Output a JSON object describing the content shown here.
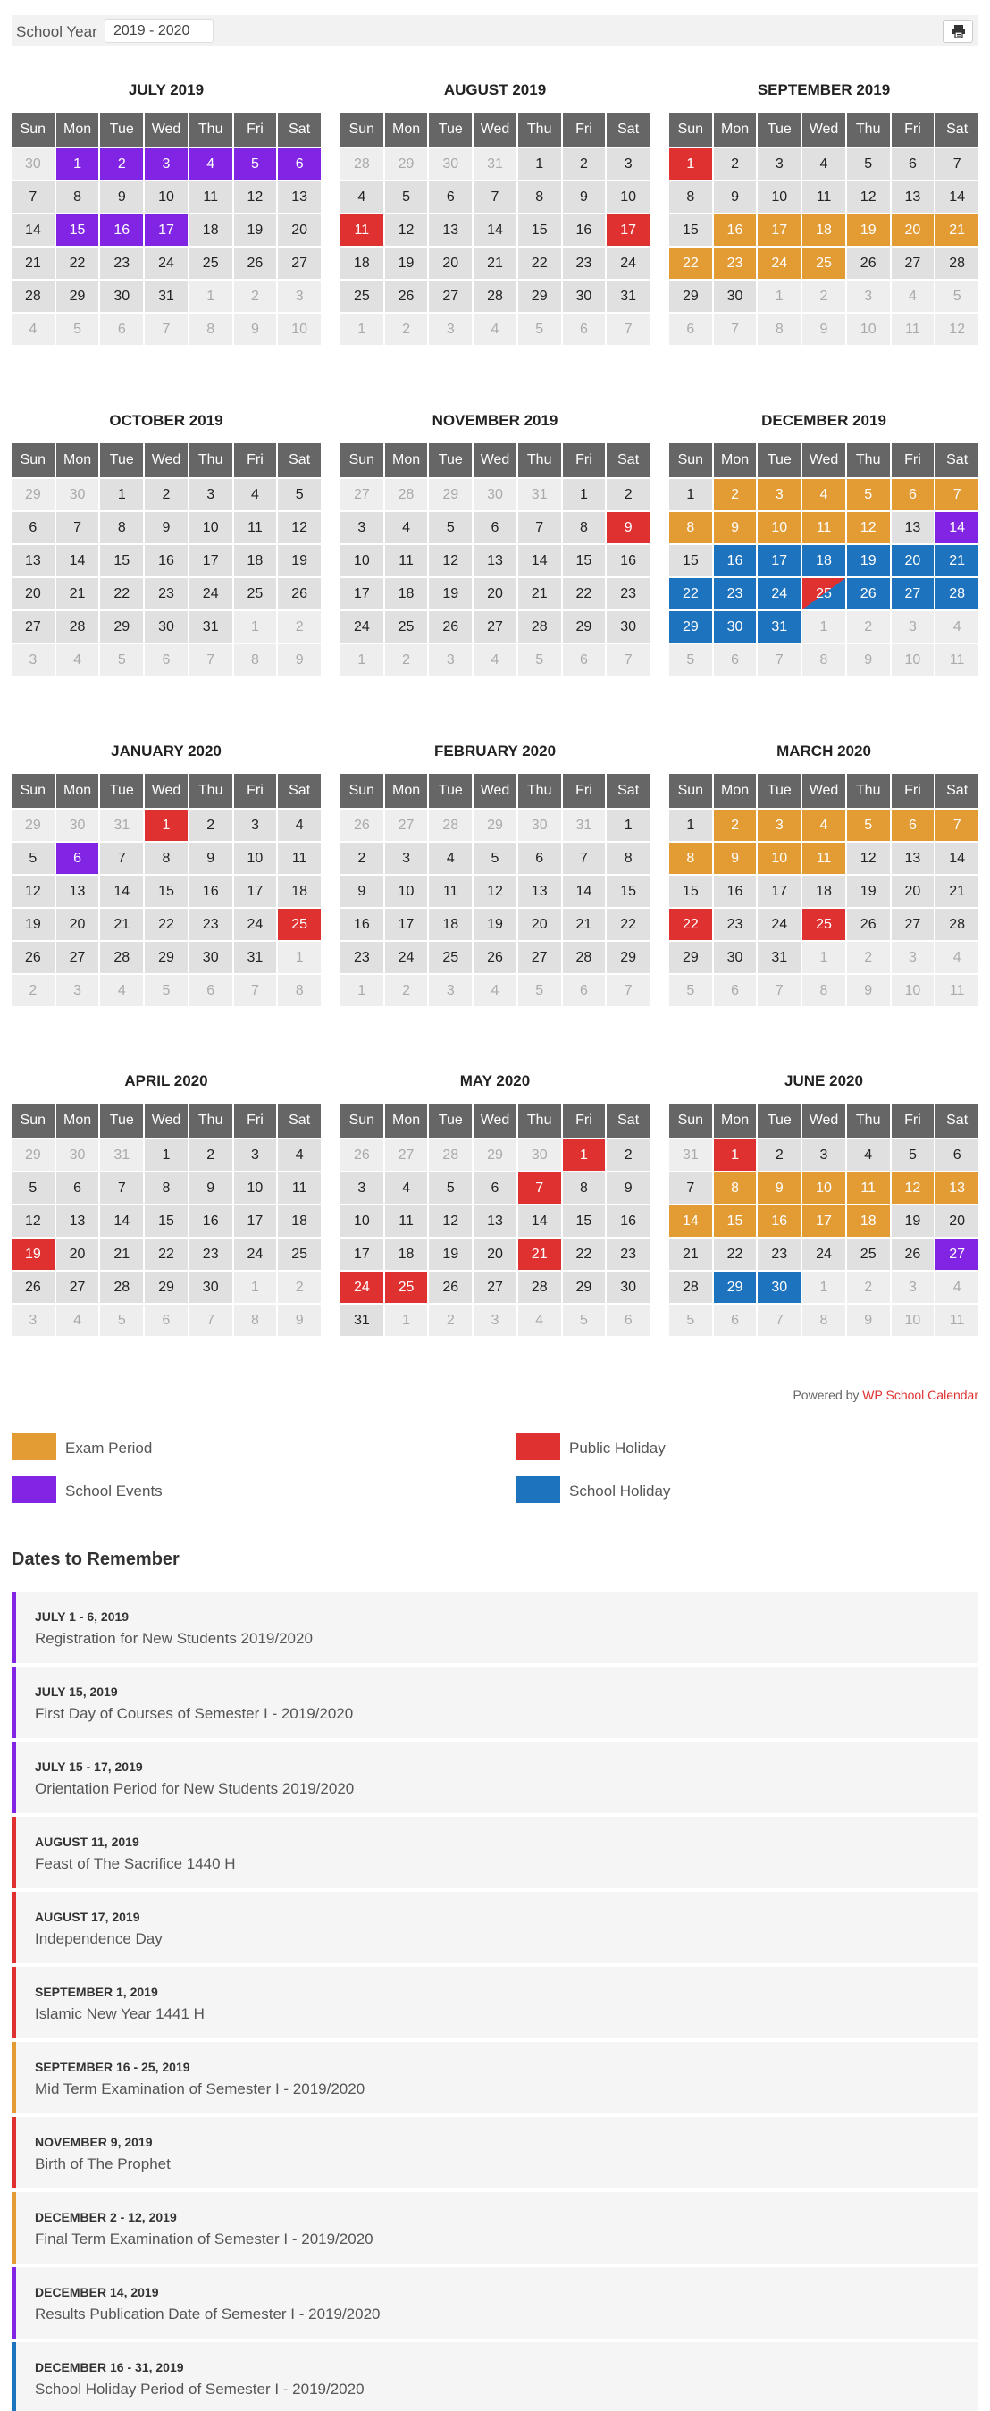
{
  "header": {
    "school_year_label": "School Year",
    "school_year_value": "2019 - 2020",
    "print_icon": "printer-icon"
  },
  "weekdays": [
    "Sun",
    "Mon",
    "Tue",
    "Wed",
    "Thu",
    "Fri",
    "Sat"
  ],
  "colors": {
    "exam": "#e39b34",
    "event": "#8224e3",
    "holiday": "#e03131",
    "school": "#1e73be",
    "header": "#666666",
    "day": "#e0e0e0",
    "other": "#eeeeee"
  },
  "months": [
    {
      "title": "JULY 2019",
      "start": 1,
      "days": 31,
      "prevDays": 30,
      "marks": {
        "1": "event",
        "2": "event",
        "3": "event",
        "4": "event",
        "5": "event",
        "6": "event",
        "15": "event",
        "16": "event",
        "17": "event"
      }
    },
    {
      "title": "AUGUST 2019",
      "start": 4,
      "days": 31,
      "prevDays": 31,
      "marks": {
        "11": "holiday",
        "17": "holiday"
      }
    },
    {
      "title": "SEPTEMBER 2019",
      "start": 0,
      "days": 30,
      "prevDays": 31,
      "marks": {
        "1": "holiday",
        "16": "exam",
        "17": "exam",
        "18": "exam",
        "19": "exam",
        "20": "exam",
        "21": "exam",
        "22": "exam",
        "23": "exam",
        "24": "exam",
        "25": "exam"
      }
    },
    {
      "title": "OCTOBER 2019",
      "start": 2,
      "days": 31,
      "prevDays": 30,
      "marks": {}
    },
    {
      "title": "NOVEMBER 2019",
      "start": 5,
      "days": 30,
      "prevDays": 31,
      "marks": {
        "9": "holiday"
      }
    },
    {
      "title": "DECEMBER 2019",
      "start": 0,
      "days": 31,
      "prevDays": 30,
      "marks": {
        "2": "exam",
        "3": "exam",
        "4": "exam",
        "5": "exam",
        "6": "exam",
        "7": "exam",
        "8": "exam",
        "9": "exam",
        "10": "exam",
        "11": "exam",
        "12": "exam",
        "14": "event",
        "16": "school",
        "17": "school",
        "18": "school",
        "19": "school",
        "20": "school",
        "21": "school",
        "22": "school",
        "23": "school",
        "24": "school",
        "25": "split",
        "26": "school",
        "27": "school",
        "28": "school",
        "29": "school",
        "30": "school",
        "31": "school"
      }
    },
    {
      "title": "JANUARY 2020",
      "start": 3,
      "days": 31,
      "prevDays": 31,
      "marks": {
        "1": "holiday",
        "6": "event",
        "25": "holiday"
      }
    },
    {
      "title": "FEBRUARY 2020",
      "start": 6,
      "days": 29,
      "prevDays": 31,
      "marks": {}
    },
    {
      "title": "MARCH 2020",
      "start": 0,
      "days": 31,
      "prevDays": 29,
      "marks": {
        "2": "exam",
        "3": "exam",
        "4": "exam",
        "5": "exam",
        "6": "exam",
        "7": "exam",
        "8": "exam",
        "9": "exam",
        "10": "exam",
        "11": "exam",
        "22": "holiday",
        "25": "holiday"
      }
    },
    {
      "title": "APRIL 2020",
      "start": 3,
      "days": 30,
      "prevDays": 31,
      "marks": {
        "19": "holiday"
      }
    },
    {
      "title": "MAY 2020",
      "start": 5,
      "days": 31,
      "prevDays": 30,
      "marks": {
        "1": "holiday",
        "7": "holiday",
        "21": "holiday",
        "24": "holiday",
        "25": "holiday"
      }
    },
    {
      "title": "JUNE 2020",
      "start": 1,
      "days": 30,
      "prevDays": 31,
      "marks": {
        "1": "holiday",
        "8": "exam",
        "9": "exam",
        "10": "exam",
        "11": "exam",
        "12": "exam",
        "13": "exam",
        "14": "exam",
        "15": "exam",
        "16": "exam",
        "17": "exam",
        "18": "exam",
        "27": "event",
        "29": "school",
        "30": "school"
      }
    }
  ],
  "powered": {
    "prefix": "Powered by",
    "link": "WP School Calendar"
  },
  "legend": [
    {
      "label": "Exam Period",
      "color": "#e39b34"
    },
    {
      "label": "Public Holiday",
      "color": "#e03131"
    },
    {
      "label": "School Events",
      "color": "#8224e3"
    },
    {
      "label": "School Holiday",
      "color": "#1e73be"
    }
  ],
  "dates_title": "Dates to Remember",
  "dates": [
    {
      "date": "JULY 1 - 6, 2019",
      "text": "Registration for New Students 2019/2020",
      "color": "#8224e3"
    },
    {
      "date": "JULY 15, 2019",
      "text": "First Day of Courses of Semester I - 2019/2020",
      "color": "#8224e3"
    },
    {
      "date": "JULY 15 - 17, 2019",
      "text": "Orientation Period for New Students 2019/2020",
      "color": "#8224e3"
    },
    {
      "date": "AUGUST 11, 2019",
      "text": "Feast of The Sacrifice 1440 H",
      "color": "#e03131"
    },
    {
      "date": "AUGUST 17, 2019",
      "text": "Independence Day",
      "color": "#e03131"
    },
    {
      "date": "SEPTEMBER 1, 2019",
      "text": "Islamic New Year 1441 H",
      "color": "#e03131"
    },
    {
      "date": "SEPTEMBER 16 - 25, 2019",
      "text": "Mid Term Examination of Semester I - 2019/2020",
      "color": "#e39b34"
    },
    {
      "date": "NOVEMBER 9, 2019",
      "text": "Birth of The Prophet",
      "color": "#e03131"
    },
    {
      "date": "DECEMBER 2 - 12, 2019",
      "text": "Final Term Examination of Semester I - 2019/2020",
      "color": "#e39b34"
    },
    {
      "date": "DECEMBER 14, 2019",
      "text": "Results Publication Date of Semester I - 2019/2020",
      "color": "#8224e3"
    },
    {
      "date": "DECEMBER 16 - 31, 2019",
      "text": "School Holiday Period of Semester I - 2019/2020",
      "color": "#1e73be"
    }
  ]
}
